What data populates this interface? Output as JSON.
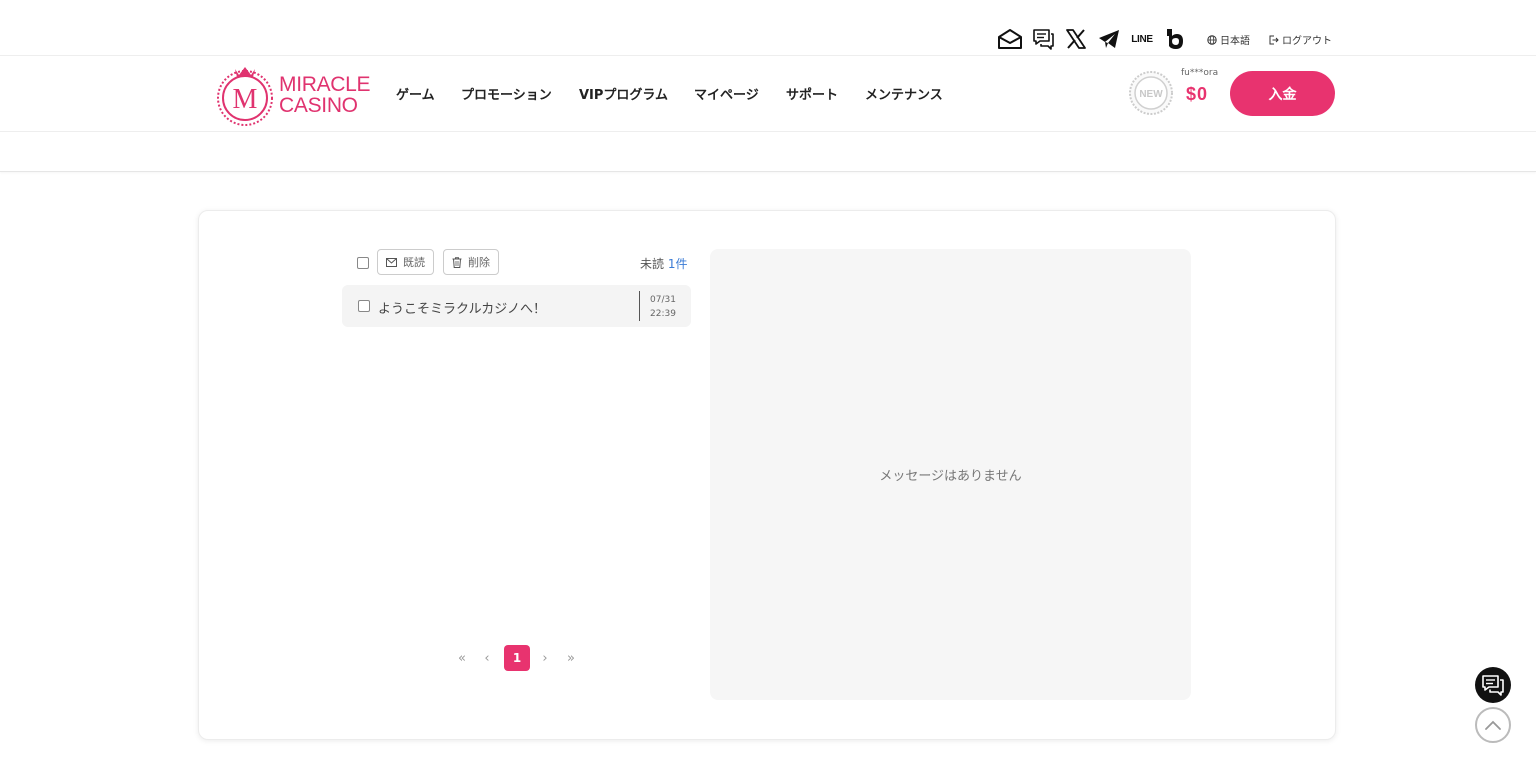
{
  "header": {
    "icons": [
      "mail-open-icon",
      "chat-icon",
      "x-icon",
      "telegram-icon",
      "line-icon",
      "b-icon"
    ],
    "line_label": "LINE",
    "language_label": "日本語",
    "logout_label": "ログアウト"
  },
  "brand": {
    "line1": "MIRACLE",
    "line2": "CASINO",
    "monogram": "M",
    "color": "#e0336f"
  },
  "nav": {
    "items": [
      {
        "label": "ゲーム"
      },
      {
        "label": "プロモーション"
      },
      {
        "label": "VIPプログラム"
      },
      {
        "label": "マイページ"
      },
      {
        "label": "サポート"
      },
      {
        "label": "メンテナンス"
      }
    ]
  },
  "user": {
    "rank_badge": "NEW",
    "username": "fu***ora",
    "balance": "$0",
    "deposit_label": "入金"
  },
  "inbox": {
    "mark_read_label": "既読",
    "delete_label": "削除",
    "unread_prefix": "未読",
    "unread_count": "1件",
    "messages": [
      {
        "subject": "ようこそミラクルカジノへ！",
        "date": "07/31",
        "time": "22:39"
      }
    ],
    "pagination": {
      "first": "«",
      "prev": "‹",
      "current": "1",
      "next": "›",
      "last": "»"
    },
    "empty_detail": "メッセージはありません"
  },
  "colors": {
    "accent": "#e8336f",
    "link": "#3a7bd5"
  }
}
